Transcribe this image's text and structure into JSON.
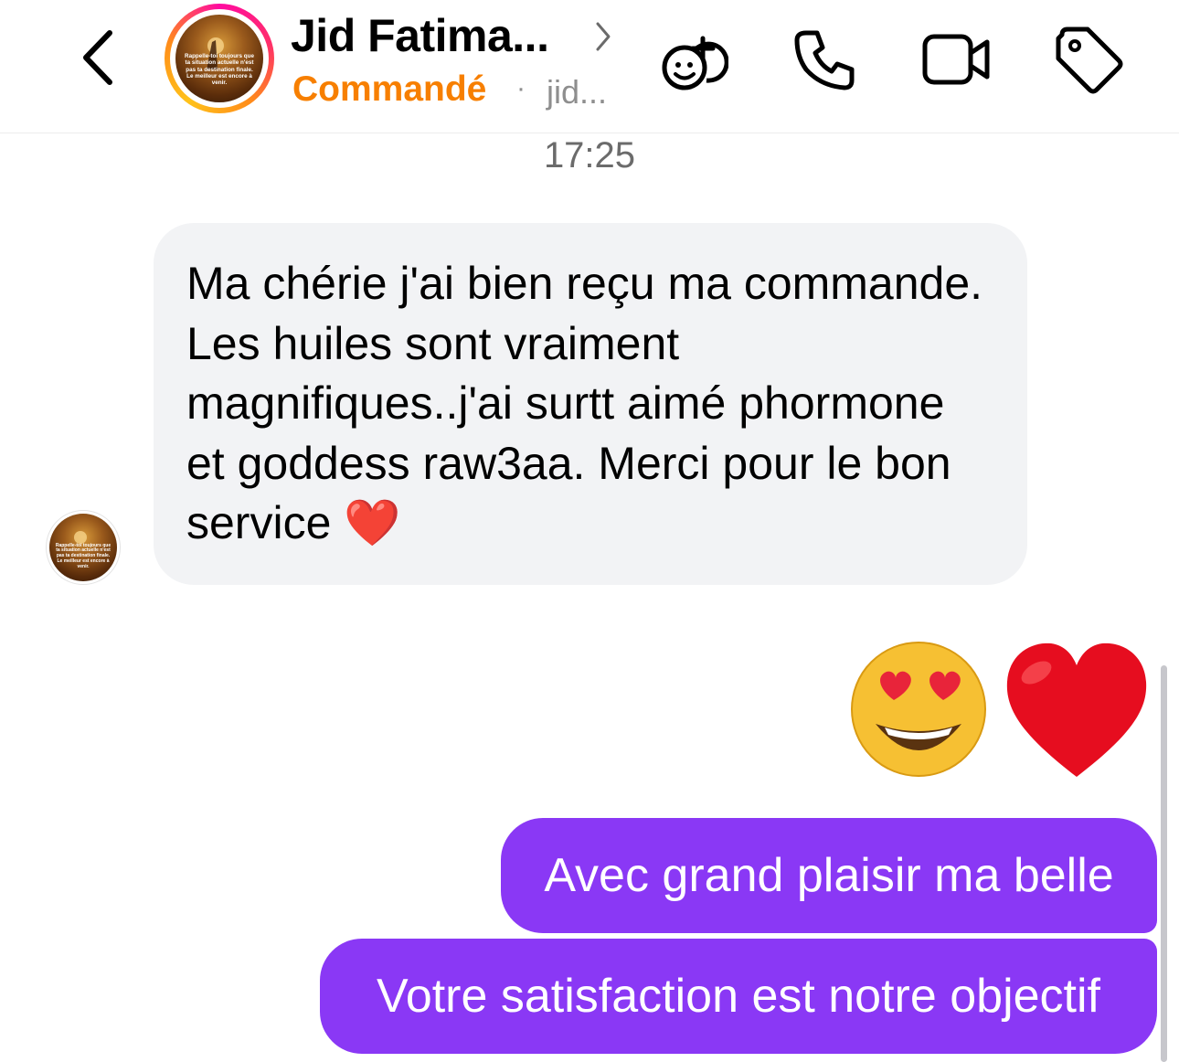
{
  "header": {
    "contact_name": "Jid Fatima...",
    "status_label": "Commandé",
    "separator": "·",
    "handle": "jid...",
    "avatar_caption": "Rappelle-toi toujours que ta situation actuelle n'est pas ta destination finale. Le meilleur est encore à venir.",
    "status_color": "#f77f00",
    "icons": [
      "back-chevron-icon",
      "add-to-group-icon",
      "phone-icon",
      "video-camera-icon",
      "tag-icon"
    ]
  },
  "conversation": {
    "timestamp": "17:25",
    "incoming": {
      "text": "Ma chérie j'ai bien reçu ma commande. Les huiles sont vraiment magnifiques..j'ai surtt aimé phormone et goddess raw3aa. Merci pour le bon service ❤️",
      "avatar_caption": "Rappelle-toi toujours que ta situation actuelle n'est pas ta destination finale. Le meilleur est encore à venir."
    },
    "reaction_emojis": [
      "smiling-face-with-heart-eyes",
      "red-heart"
    ],
    "outgoing": [
      {
        "text": "Avec grand plaisir ma belle"
      },
      {
        "text": "Votre satisfaction est notre objectif"
      }
    ],
    "outgoing_bubble_color": "#8a38f5",
    "incoming_bubble_color": "#f2f3f5"
  }
}
